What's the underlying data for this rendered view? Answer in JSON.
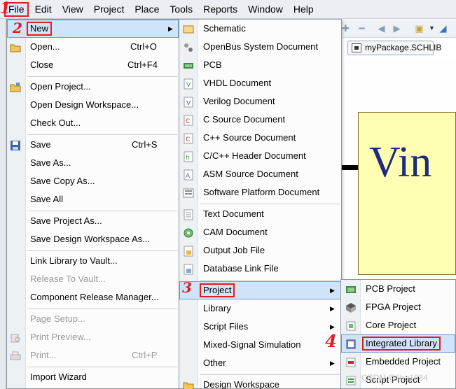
{
  "menubar": {
    "items": [
      {
        "key": "file",
        "label": "File"
      },
      {
        "key": "edit",
        "label": "Edit"
      },
      {
        "key": "view",
        "label": "View"
      },
      {
        "key": "project",
        "label": "Project"
      },
      {
        "key": "place",
        "label": "Place"
      },
      {
        "key": "tools",
        "label": "Tools"
      },
      {
        "key": "reports",
        "label": "Reports"
      },
      {
        "key": "window",
        "label": "Window"
      },
      {
        "key": "help",
        "label": "Help"
      }
    ]
  },
  "annotations": {
    "step1": "1",
    "step2": "2",
    "step3": "3",
    "step4": "4"
  },
  "document_tab": {
    "label": "myPackage.SCHLIB"
  },
  "schematic": {
    "pin_text": "Vin"
  },
  "file_menu": {
    "new": "New",
    "open": "Open...",
    "open_shortcut": "Ctrl+O",
    "close": "Close",
    "close_shortcut": "Ctrl+F4",
    "open_project": "Open Project...",
    "open_workspace": "Open Design Workspace...",
    "check_out": "Check Out...",
    "save": "Save",
    "save_shortcut": "Ctrl+S",
    "save_as": "Save As...",
    "save_copy_as": "Save Copy As...",
    "save_all": "Save All",
    "save_project_as": "Save Project As...",
    "save_workspace_as": "Save Design Workspace As...",
    "link_library": "Link Library to Vault...",
    "release_to_vault": "Release To Vault...",
    "component_release_manager": "Component Release Manager...",
    "page_setup": "Page Setup...",
    "print_preview": "Print Preview...",
    "print": "Print...",
    "print_shortcut": "Ctrl+P",
    "import_wizard": "Import Wizard"
  },
  "new_menu": {
    "schematic": "Schematic",
    "openbus": "OpenBus System Document",
    "pcb": "PCB",
    "vhdl": "VHDL Document",
    "verilog": "Verilog Document",
    "c_source": "C Source Document",
    "cpp_source": "C++ Source Document",
    "c_header": "C/C++ Header Document",
    "asm_source": "ASM Source Document",
    "software_platform": "Software Platform Document",
    "text_doc": "Text Document",
    "cam_doc": "CAM Document",
    "output_job": "Output Job File",
    "db_link": "Database Link File",
    "project": "Project",
    "library": "Library",
    "script_files": "Script Files",
    "mixed_signal": "Mixed-Signal Simulation",
    "other": "Other",
    "design_workspace": "Design Workspace"
  },
  "project_menu": {
    "pcb_project": "PCB Project",
    "fpga_project": "FPGA Project",
    "core_project": "Core Project",
    "integrated_library": "Integrated Library",
    "embedded_project": "Embedded Project",
    "script_project": "Script Project"
  },
  "watermark": {
    "text": "CSDN @libu1834"
  },
  "colors": {
    "highlight": "#cfe3f9",
    "annotation_red": "#e01d1d",
    "vin_fill": "#ffffb4",
    "vin_text": "#1f2a7a"
  }
}
